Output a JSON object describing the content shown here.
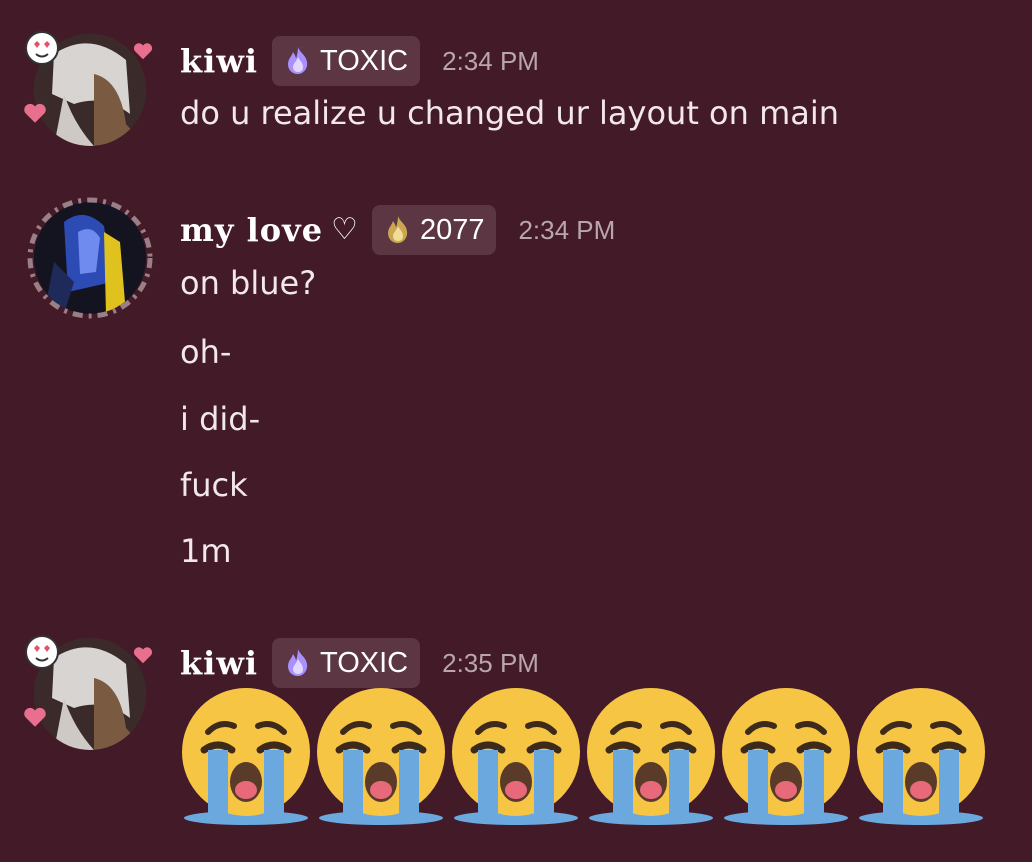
{
  "messages": [
    {
      "author": "kiwi",
      "tag": "TOXIC",
      "tag_icon": "purple-flame-icon",
      "time": "2:34 PM",
      "lines": [
        "do u realize u changed ur layout on main"
      ]
    },
    {
      "author": "my love",
      "author_suffix": "♡",
      "tag": "2077",
      "tag_icon": "gold-flame-icon",
      "time": "2:34 PM",
      "lines": [
        "on blue?",
        "oh-",
        "i did-",
        "fuck",
        "1m"
      ]
    },
    {
      "author": "kiwi",
      "tag": "TOXIC",
      "tag_icon": "purple-flame-icon",
      "time": "2:35 PM",
      "emojis": [
        "😭",
        "😭",
        "😭",
        "😭",
        "😭",
        "😭"
      ]
    }
  ],
  "colors": {
    "background": "#421a28",
    "tag_background": "#5c3643",
    "timestamp": "#b9a6ad",
    "text": "#f2e7ea"
  }
}
